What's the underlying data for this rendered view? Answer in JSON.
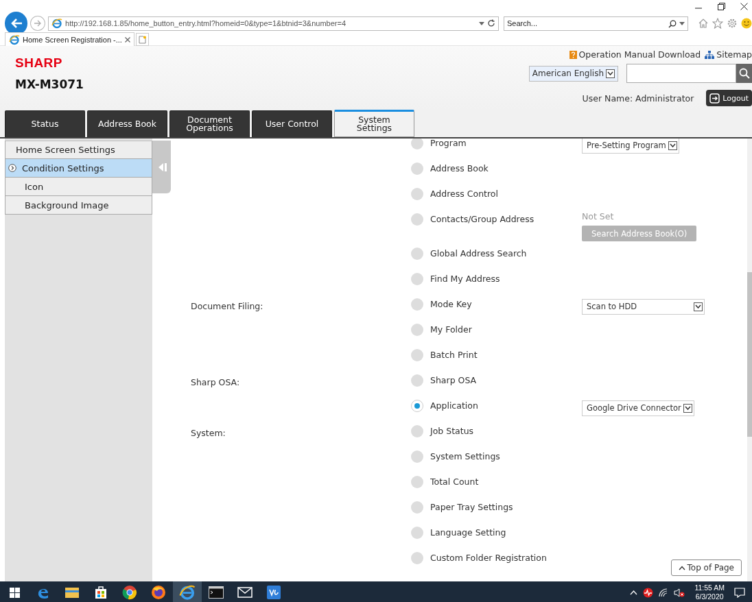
{
  "browser": {
    "url": "http://192.168.1.85/home_button_entry.html?homeid=0&type=1&btnid=3&number=4",
    "search_placeholder": "Search...",
    "tabs": [
      {
        "title": "Home Screen Registration -...",
        "selected": true
      }
    ]
  },
  "header": {
    "logo": "SHARP",
    "model": "MX-M3071",
    "links": [
      {
        "kind": "manual",
        "label": "Operation Manual Download"
      },
      {
        "kind": "sitemap",
        "label": "Sitemap"
      }
    ],
    "language": "American English",
    "user": "User Name: Administrator",
    "logout": "Logout"
  },
  "tabs": [
    {
      "label": "Status",
      "selected": false
    },
    {
      "label": "Address Book",
      "selected": false
    },
    {
      "label": "Document Operations",
      "selected": false
    },
    {
      "label": "User Control",
      "selected": false
    },
    {
      "label": "System Settings",
      "selected": true
    }
  ],
  "sidebar": {
    "items": [
      {
        "label": "Home Screen Settings",
        "selected": false,
        "children": [
          {
            "label": "Condition Settings",
            "selected": true
          },
          {
            "label": "Icon",
            "selected": false
          },
          {
            "label": "Background Image",
            "selected": false
          }
        ]
      }
    ]
  },
  "rows": [
    {
      "label": "Program",
      "selected": false,
      "control": {
        "kind": "select",
        "value": "Pre-Setting Program"
      }
    },
    {
      "label": "Address Book",
      "selected": false
    },
    {
      "label": "Address Control",
      "selected": false
    },
    {
      "label": "Contacts/Group Address",
      "selected": false,
      "control": {
        "kind": "address",
        "status": "Not Set",
        "button": "Search Address Book(O)"
      }
    },
    {
      "label": "Global Address Search",
      "selected": false
    },
    {
      "label": "Find My Address",
      "selected": false
    },
    {
      "section": "Document Filing:",
      "label": "Mode Key",
      "selected": false,
      "control": {
        "kind": "select",
        "value": "Scan to HDD"
      }
    },
    {
      "label": "My Folder",
      "selected": false
    },
    {
      "label": "Batch Print",
      "selected": false
    },
    {
      "section": "Sharp OSA:",
      "label": "Sharp OSA",
      "selected": false
    },
    {
      "label": "Application",
      "selected": true,
      "control": {
        "kind": "select",
        "value": "Google Drive Connector"
      }
    },
    {
      "section": "System:",
      "label": "Job Status",
      "selected": false
    },
    {
      "label": "System Settings",
      "selected": false
    },
    {
      "label": "Total Count",
      "selected": false
    },
    {
      "label": "Paper Tray Settings",
      "selected": false
    },
    {
      "label": "Language Setting",
      "selected": false
    },
    {
      "label": "Custom Folder Registration",
      "selected": false
    }
  ],
  "top_button": "Top of Page",
  "taskbar": {
    "apps": [
      {
        "kind": "edge",
        "selected": false
      },
      {
        "kind": "explorer",
        "selected": false
      },
      {
        "kind": "store",
        "selected": false
      },
      {
        "kind": "chrome",
        "selected": false
      },
      {
        "kind": "firefox",
        "selected": false
      },
      {
        "kind": "ie",
        "selected": true
      },
      {
        "kind": "terminal",
        "selected": false
      },
      {
        "kind": "mail",
        "selected": false
      },
      {
        "kind": "vs",
        "selected": false
      }
    ],
    "time": "11:55 AM",
    "date": "6/3/2020"
  }
}
